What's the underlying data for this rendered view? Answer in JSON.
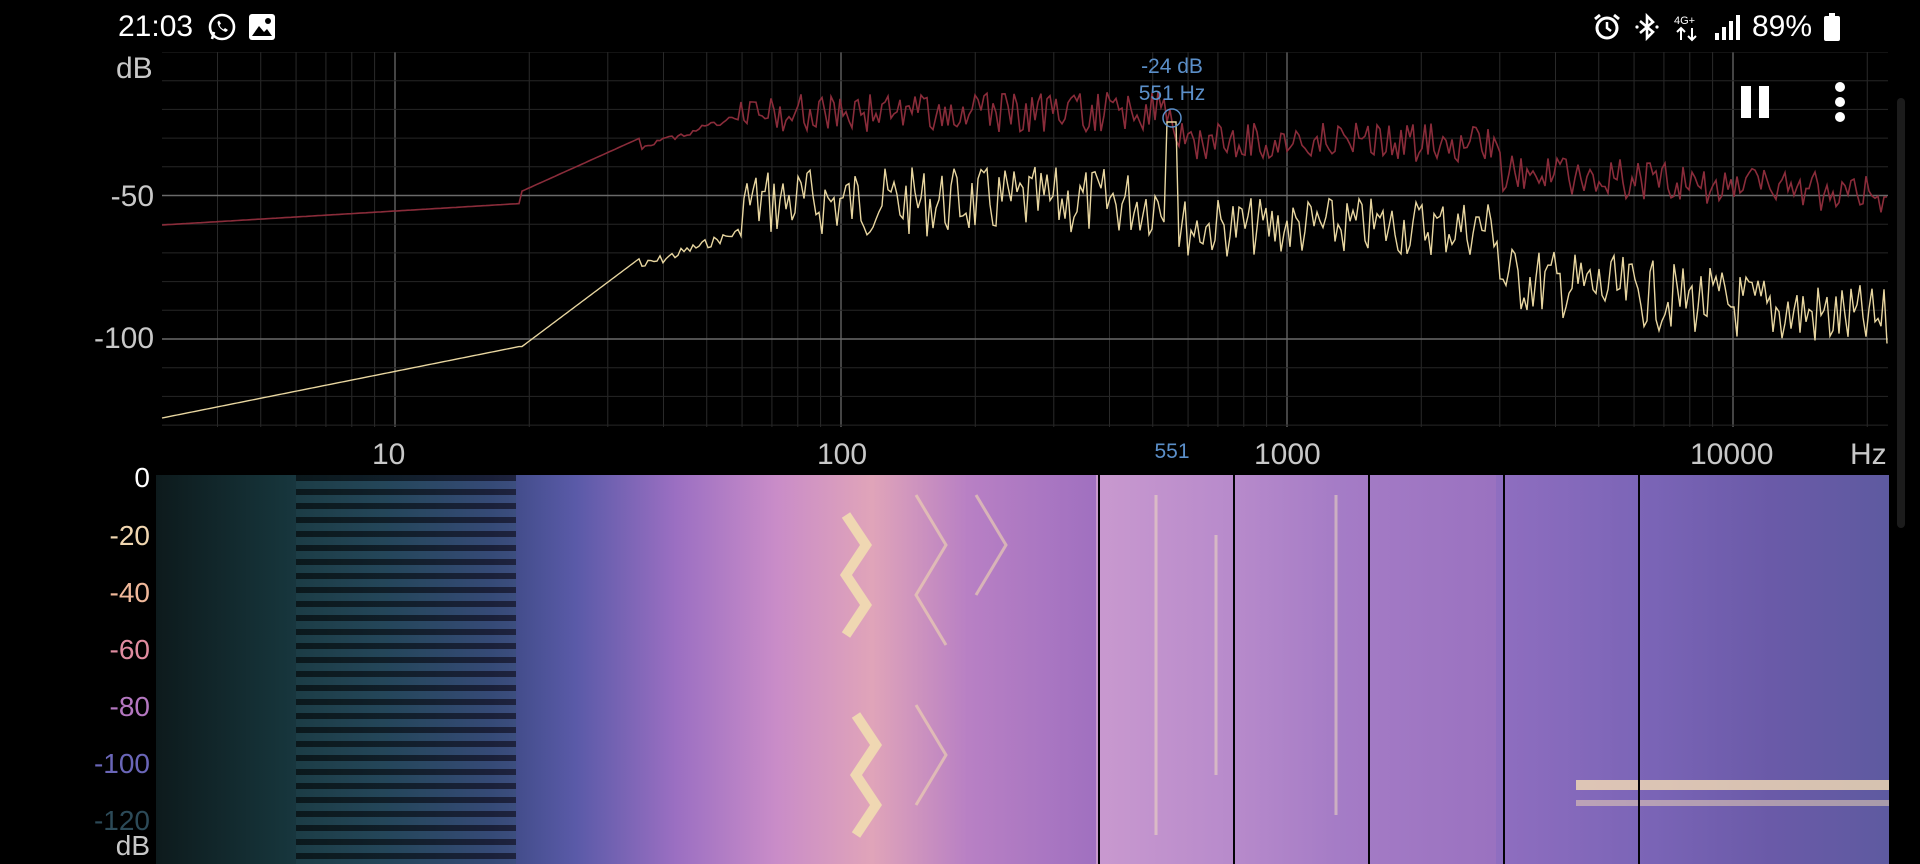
{
  "status_bar": {
    "time": "21:03",
    "left_icons": [
      "whatsapp-icon",
      "gallery-icon"
    ],
    "right_icons": [
      "alarm-icon",
      "bluetooth-icon",
      "4g-plus-icon",
      "signal-icon"
    ],
    "battery": "89%"
  },
  "spectrum": {
    "y_unit": "dB",
    "y_ticks": [
      "-50",
      "-100"
    ],
    "x_ticks": [
      "10",
      "100",
      "1000",
      "10000"
    ],
    "x_unit": "Hz",
    "peak": {
      "level": "-24 dB",
      "freq": "551 Hz",
      "marker": "551"
    },
    "colors": {
      "peak_hold": "#8a2c3a",
      "live": "#e8d6a0",
      "peak_marker": "#5b8fc9"
    }
  },
  "spectrogram": {
    "y_ticks": [
      "0",
      "-20",
      "-40",
      "-60",
      "-80",
      "-100",
      "-120"
    ],
    "y_unit": "dB"
  },
  "controls": {
    "pause_icon": "pause-icon",
    "menu_icon": "more-vert-icon"
  }
}
